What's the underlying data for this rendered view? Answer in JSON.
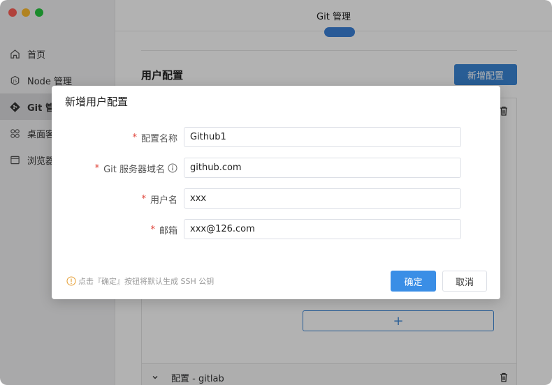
{
  "window": {
    "title": "Git 管理"
  },
  "sidebar": {
    "items": [
      {
        "label": "首页",
        "icon": "home-icon"
      },
      {
        "label": "Node 管理",
        "icon": "node-icon"
      },
      {
        "label": "Git 管理",
        "icon": "git-icon"
      },
      {
        "label": "桌面客",
        "icon": "grid-icon"
      },
      {
        "label": "浏览器",
        "icon": "browser-icon"
      }
    ]
  },
  "main": {
    "section_title": "用户配置",
    "add_button": "新增配置",
    "second_card_label": "配置 - gitlab",
    "add_row_symbol": "+"
  },
  "modal": {
    "title": "新增用户配置",
    "fields": [
      {
        "label": "配置名称",
        "value": "Github1"
      },
      {
        "label": "Git 服务器域名",
        "value": "github.com"
      },
      {
        "label": "用户名",
        "value": "xxx"
      },
      {
        "label": "邮箱",
        "value": "xxx@126.com"
      }
    ],
    "required_mark": "*",
    "hint": "点击『确定』按钮将默认生成 SSH 公钥",
    "ok_label": "确定",
    "cancel_label": "取消"
  },
  "colors": {
    "primary": "#3a86d6",
    "required": "#e0443a",
    "warning": "#e6a23c"
  }
}
